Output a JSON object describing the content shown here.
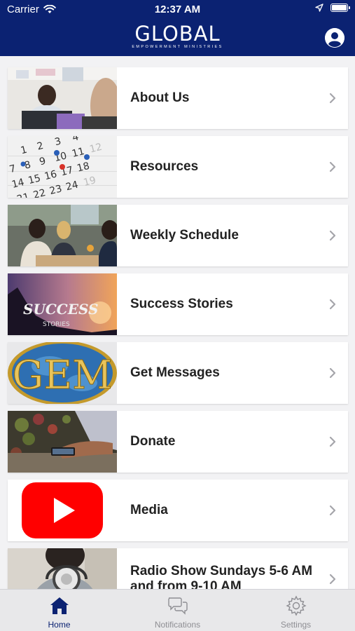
{
  "status_bar": {
    "carrier": "Carrier",
    "time": "12:37 AM",
    "icons": [
      "wifi-icon",
      "location-arrow-icon",
      "battery-icon"
    ]
  },
  "header": {
    "logo_text": "GLOBAL",
    "logo_subtext": "EMPOWERMENT MINISTRIES",
    "background": "#0b2272",
    "profile_icon": "user-circle-icon"
  },
  "menu": {
    "items": [
      {
        "label": "About Us",
        "thumb": "meeting-photo"
      },
      {
        "label": "Resources",
        "thumb": "calendar-photo"
      },
      {
        "label": "Weekly Schedule",
        "thumb": "cafe-meeting-photo"
      },
      {
        "label": "Success Stories",
        "thumb": "success-stories-graphic"
      },
      {
        "label": "Get Messages",
        "thumb": "gem-logo"
      },
      {
        "label": "Donate",
        "thumb": "phone-hands-photo"
      },
      {
        "label": "Media",
        "thumb": "youtube-logo"
      },
      {
        "label": "Radio Show Sundays 5-6 AM and from 9-10 AM",
        "thumb": "headphones-photo"
      }
    ]
  },
  "tabbar": {
    "active": "Home",
    "accent": "#0b2272",
    "inactive_color": "#8e8e93",
    "tabs": [
      {
        "label": "Home",
        "icon": "home-icon"
      },
      {
        "label": "Notifications",
        "icon": "chat-bubbles-icon"
      },
      {
        "label": "Settings",
        "icon": "gear-icon"
      }
    ]
  }
}
